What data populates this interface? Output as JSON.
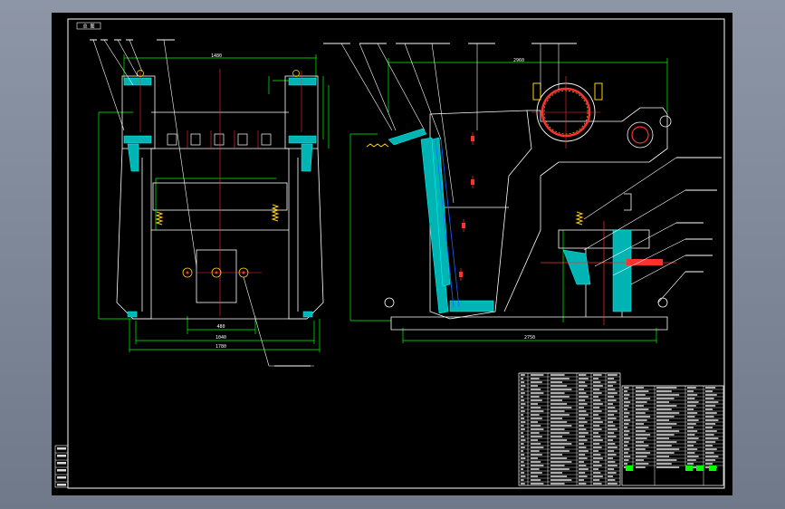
{
  "drawing": {
    "tag": "总 图",
    "dims": {
      "top_left": "1480",
      "bottom_inner": "480",
      "bottom_mid": "1040",
      "bottom_total": "1780",
      "top_right": "2960",
      "bottom_right": "2750"
    }
  },
  "colors": {
    "background": "#000000",
    "outline": "#ffffff",
    "dimension": "#00ff00",
    "section": "#00c8c8",
    "centerline": "#ff3030",
    "spring": "#ffd200",
    "blue": "#1e64ff"
  }
}
